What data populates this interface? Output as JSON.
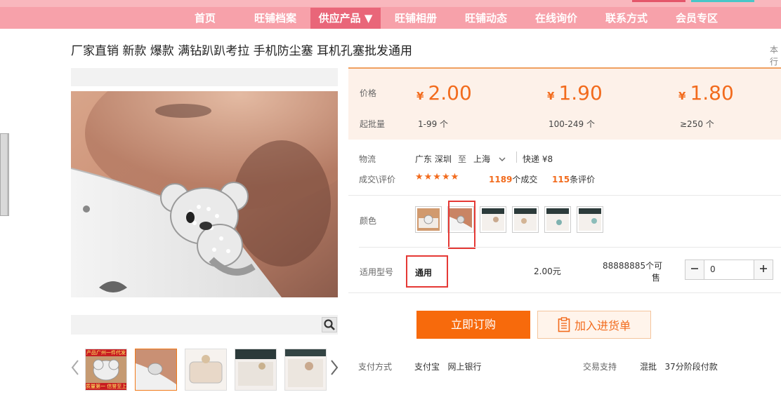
{
  "nav": {
    "items": [
      "首页",
      "旺铺档案",
      "供应产品 ▼",
      "旺铺相册",
      "旺铺动态",
      "在线询价",
      "联系方式",
      "会员专区"
    ],
    "active_index": 2
  },
  "product": {
    "title": "厂家直销 新款 爆款 满钻趴趴考拉 手机防尘塞 耳机孔塞批发通用",
    "right_cut_text": "本行"
  },
  "gallery": {
    "thumb_top_caption": "产品广州一件代发",
    "thumb_bottom_caption": "质量第一 信誉至上"
  },
  "price": {
    "price_label": "价格",
    "moq_label": "起批量",
    "currency": "¥",
    "tiers": [
      {
        "price": "2.00",
        "range": "1-99 个"
      },
      {
        "price": "1.90",
        "range": "100-249 个"
      },
      {
        "price": "1.80",
        "range": "≥250 个"
      }
    ]
  },
  "logistics": {
    "label": "物流",
    "from": "广东 深圳",
    "to_word": "至",
    "to": "上海",
    "express": "快递 ¥8"
  },
  "deals": {
    "label": "成交\\评价",
    "stars": "★★★★★",
    "deal_count": "1189",
    "deal_suffix": "个成交",
    "review_count": "115",
    "review_suffix": "条评价"
  },
  "color": {
    "label": "颜色",
    "selected_index": 1
  },
  "model": {
    "label": "适用型号",
    "value": "通用",
    "unit_price": "2.00元",
    "stock_line1": "88888885个可",
    "stock_line2": "售",
    "quantity": "0"
  },
  "actions": {
    "buy_label": "立即订购",
    "cart_label": "加入进货单"
  },
  "payment": {
    "label": "支付方式",
    "methods": "支付宝   网上银行",
    "support_label": "交易支持",
    "support_values": "混批   37分阶段付款"
  },
  "colors": {
    "nav_bg": "#f7a1aa",
    "nav_active": "#e96679",
    "accent_orange": "#f26b1d",
    "buy_orange": "#f76a0c",
    "price_bg": "#fdf1e9",
    "highlight_red": "#e53935"
  }
}
